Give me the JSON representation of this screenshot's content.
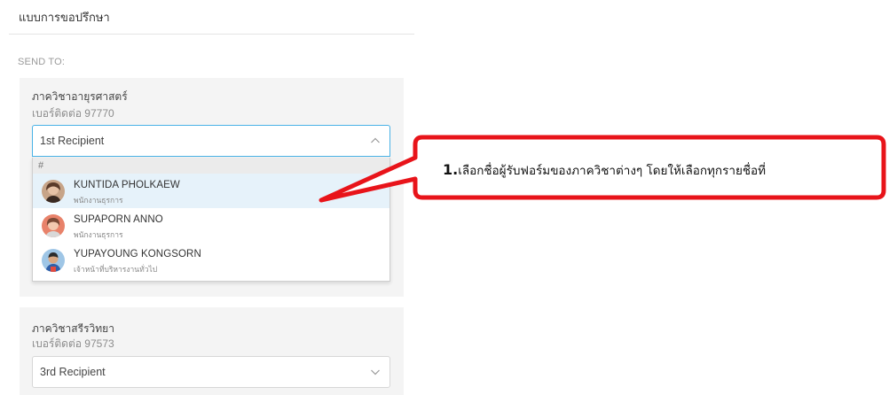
{
  "form": {
    "title": "แบบการขอปรึกษา",
    "send_to_label": "SEND TO:"
  },
  "sections": [
    {
      "department": "ภาควิชาอายุรศาสตร์",
      "phone": "เบอร์ติดต่อ 97770",
      "select": {
        "value": "1st Recipient",
        "state": "open"
      },
      "dropdown": {
        "group": "#",
        "options": [
          {
            "name": "KUNTIDA PHOLKAEW",
            "role": "พนักงานธุรการ",
            "avatar": "woman-avatar-icon",
            "highlighted": true
          },
          {
            "name": "SUPAPORN ANNO",
            "role": "พนักงานธุรการ",
            "avatar": "woman-avatar-icon",
            "highlighted": false
          },
          {
            "name": "YUPAYOUNG KONGSORN",
            "role": "เจ้าหน้าที่บริหารงานทั่วไป",
            "avatar": "man-avatar-icon",
            "highlighted": false
          }
        ]
      }
    },
    {
      "department": "ภาควิชาสรีรวิทยา",
      "phone": "เบอร์ติดต่อ 97573",
      "select": {
        "value": "3rd Recipient",
        "state": "closed"
      }
    }
  ],
  "callout": {
    "number": "1.",
    "text": "เลือกชื่อผู้รับฟอร์มของภาควิชาต่างๆ โดยให้เลือกทุกรายชื่อที่"
  },
  "colors": {
    "accent_border": "#49b2e6",
    "highlight_row": "#e6f2fa",
    "callout_red": "#e8141a",
    "section_bg": "#f4f4f4"
  }
}
